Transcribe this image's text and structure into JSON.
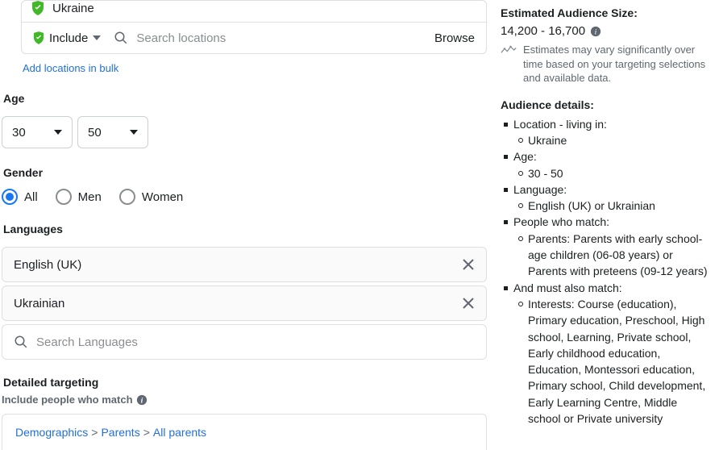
{
  "locations": {
    "selected": "Ukraine",
    "include_label": "Include",
    "search_placeholder": "Search locations",
    "browse_label": "Browse",
    "add_bulk": "Add locations in bulk"
  },
  "age": {
    "label": "Age",
    "min": "30",
    "max": "50"
  },
  "gender": {
    "label": "Gender",
    "options": {
      "all": "All",
      "men": "Men",
      "women": "Women"
    },
    "selected": "all"
  },
  "languages": {
    "label": "Languages",
    "items": [
      "English (UK)",
      "Ukrainian"
    ],
    "search_placeholder": "Search Languages"
  },
  "detailed": {
    "label": "Detailed targeting",
    "sub_label": "Include people who match",
    "crumbs": [
      "Demographics",
      "Parents",
      "All parents"
    ]
  },
  "audience": {
    "size_label": "Estimated Audience Size:",
    "range": "14,200 - 16,700",
    "note": "Estimates may vary significantly over time based on your targeting selections and available data.",
    "details_label": "Audience details:",
    "details": {
      "location_label": "Location - living in:",
      "location_value": "Ukraine",
      "age_label": "Age:",
      "age_value": "30 - 50",
      "language_label": "Language:",
      "language_value": "English (UK) or Ukrainian",
      "match_label": "People who match:",
      "match_value": "Parents: Parents with early school-age children (06-08 years) or Parents with preteens (09-12 years)",
      "also_label": "And must also match:",
      "also_value": "Interests: Course (education), Primary education, Preschool, High school, Learning, Private school, Early childhood education, Education, Montessori education, Primary school, Child development, Early Learning Centre, Middle school or Private university"
    }
  }
}
